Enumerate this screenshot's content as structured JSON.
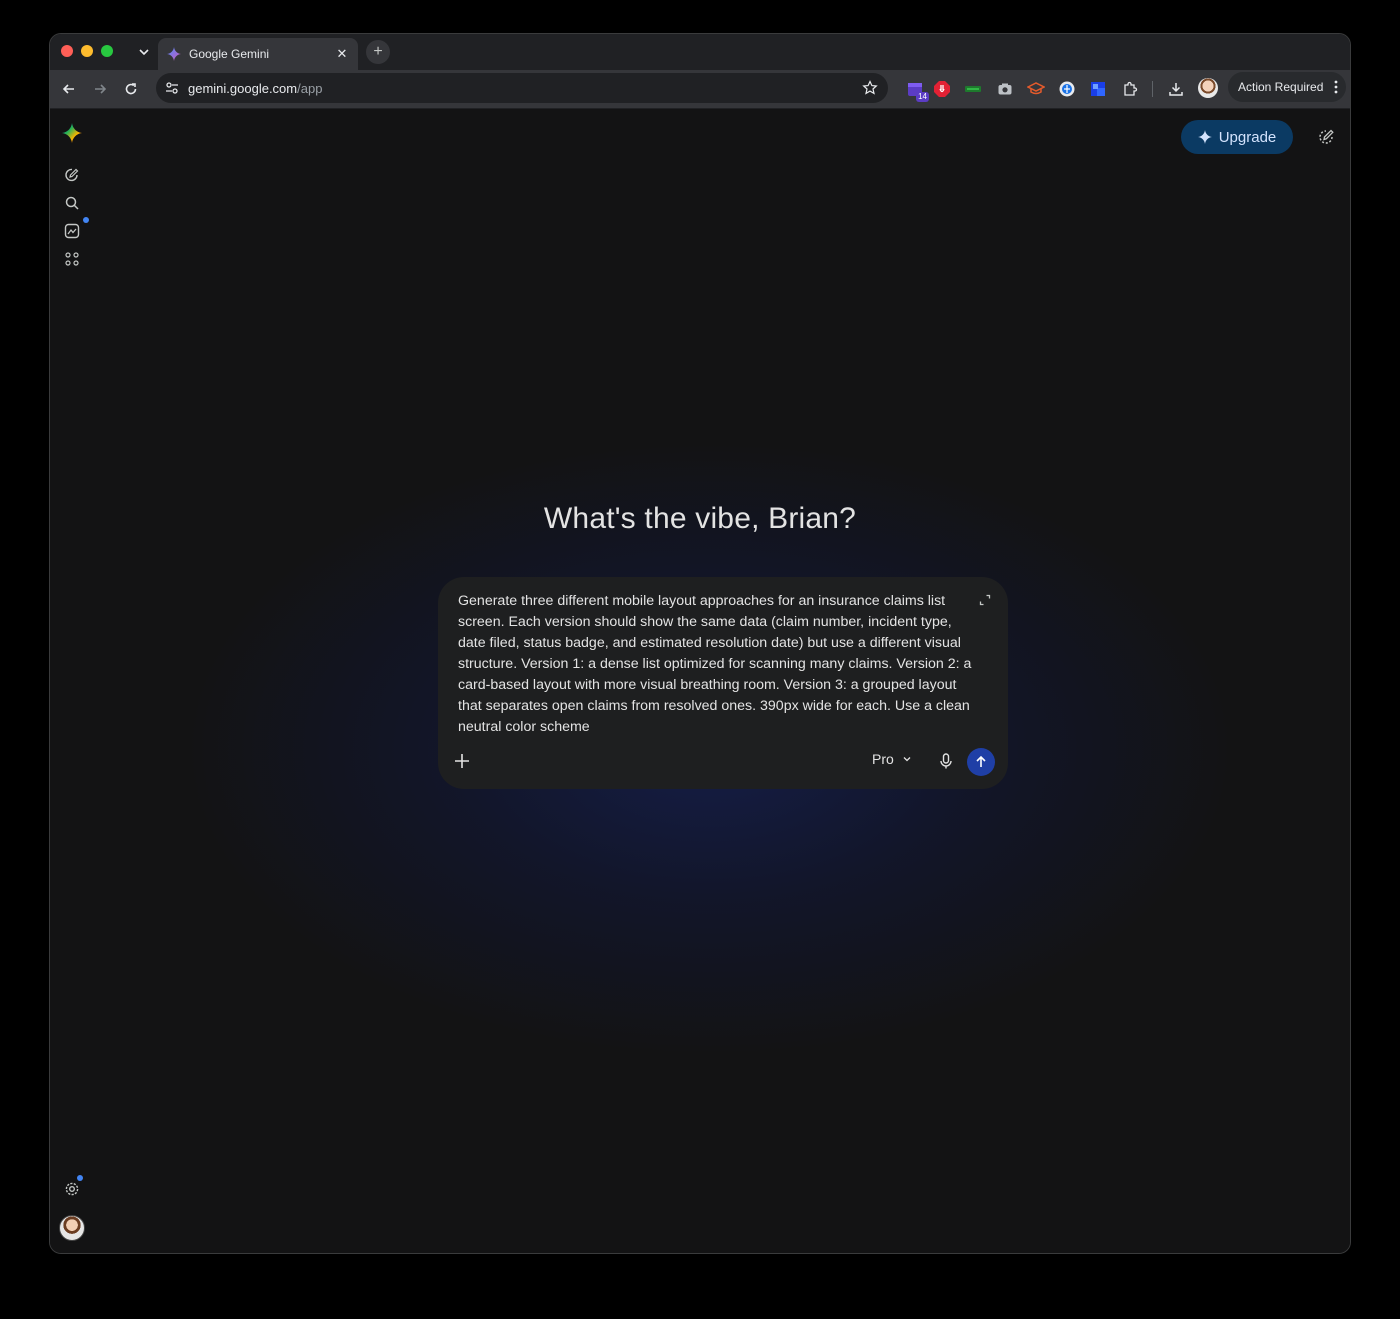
{
  "browser": {
    "tab": {
      "title": "Google Gemini"
    },
    "address": {
      "domain": "gemini.google.com",
      "path": "/app"
    },
    "extensions": {
      "badge_count": "14"
    },
    "action_required_label": "Action Required"
  },
  "app": {
    "upgrade_label": "Upgrade",
    "greeting": "What's the vibe, Brian?",
    "composer": {
      "prompt_text": "Generate three different mobile layout approaches for an insurance claims list screen. Each version should show the same data (claim number, incident type, date filed, status badge, and estimated resolution date) but use a different visual structure. Version 1: a dense list optimized for scanning many claims. Version 2: a card-based layout with more visual breathing room. Version 3: a grouped layout that separates open claims from resolved ones. 390px wide for each. Use a clean neutral color scheme",
      "model_label": "Pro"
    }
  },
  "colors": {
    "accent_blue": "#4285f4",
    "send_button": "#1f3fa6",
    "upgrade_bg": "#0b3a63",
    "background": "#131314"
  }
}
